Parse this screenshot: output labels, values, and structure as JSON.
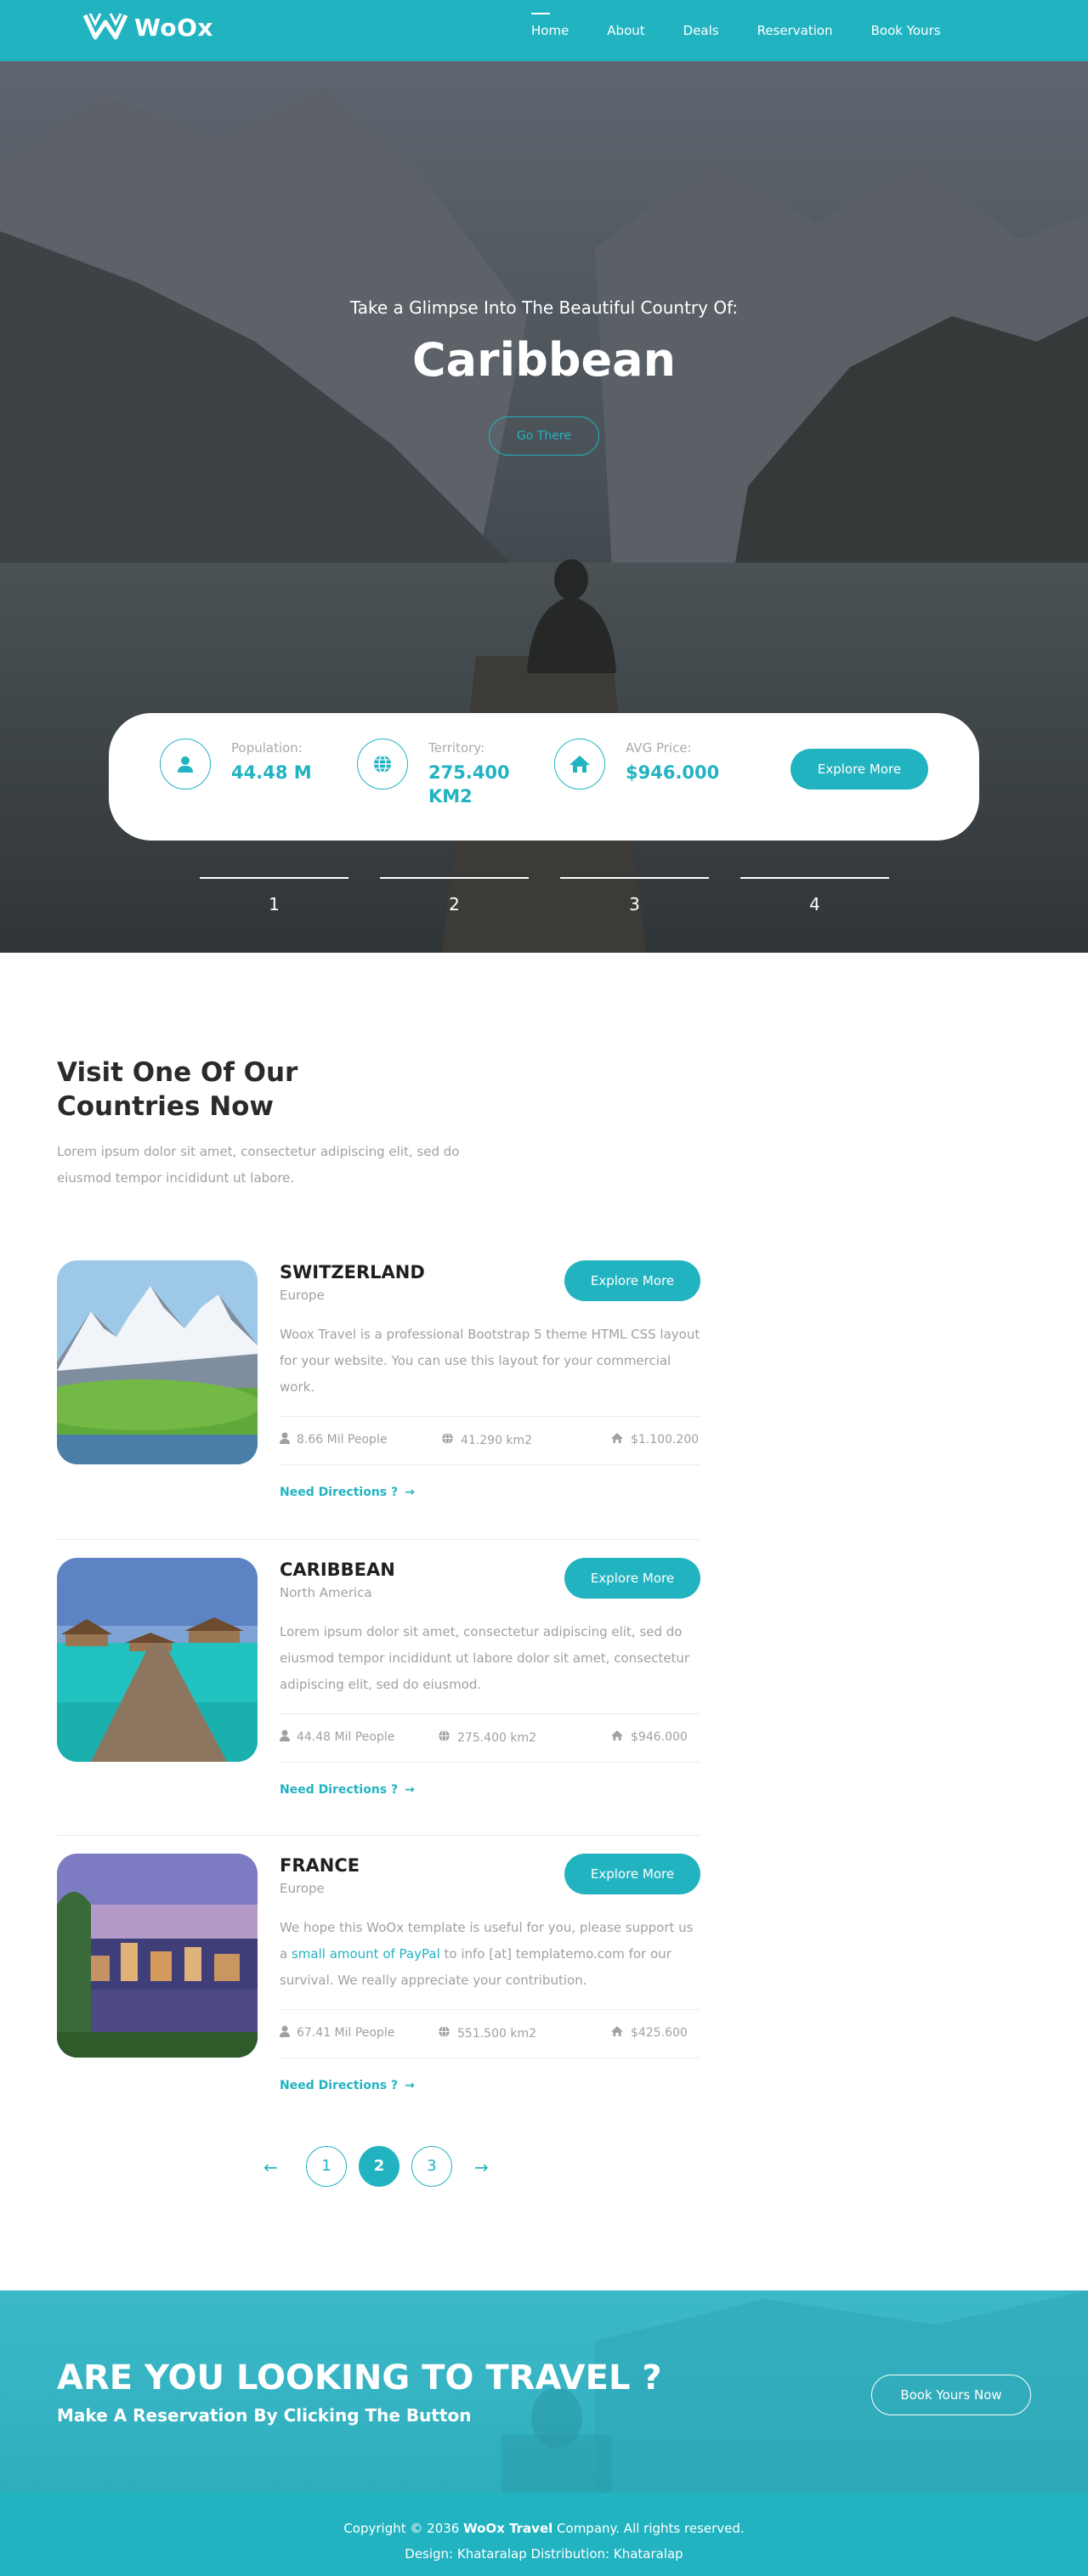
{
  "brand": {
    "name": "WoOx"
  },
  "nav": {
    "items": [
      {
        "label": "Home",
        "active": true
      },
      {
        "label": "About"
      },
      {
        "label": "Deals"
      },
      {
        "label": "Reservation"
      },
      {
        "label": "Book Yours"
      }
    ]
  },
  "hero": {
    "subtitle": "Take a Glimpse Into The Beautiful Country Of:",
    "title": "Caribbean",
    "cta_label": "Go There",
    "info": {
      "population": {
        "label": "Population:",
        "value": "44.48 M"
      },
      "territory": {
        "label": "Territory:",
        "value_line1": "275.400",
        "value_line2": "KM2"
      },
      "avg_price": {
        "label": "AVG Price:",
        "value": "$946.000"
      },
      "explore_label": "Explore More"
    },
    "slides": [
      "1",
      "2",
      "3",
      "4"
    ]
  },
  "countries_section": {
    "title": "Visit One Of Our Countries Now",
    "description": "Lorem ipsum dolor sit amet, consectetur adipiscing elit, sed do eiusmod tempor incididunt ut labore.",
    "items": [
      {
        "name": "SWITZERLAND",
        "region": "Europe",
        "explore_label": "Explore More",
        "description": "Woox Travel is a professional Bootstrap 5 theme HTML CSS layout for your website. You can use this layout for your commercial work.",
        "people": "8.66 Mil People",
        "area": "41.290 km2",
        "price": "$1.100.200",
        "directions_label": "Need Directions ?"
      },
      {
        "name": "CARIBBEAN",
        "region": "North America",
        "explore_label": "Explore More",
        "description": "Lorem ipsum dolor sit amet, consectetur adipiscing elit, sed do eiusmod tempor incididunt ut labore dolor sit amet, consectetur adipiscing elit, sed do eiusmod.",
        "people": "44.48 Mil People",
        "area": "275.400 km2",
        "price": "$946.000",
        "directions_label": "Need Directions ?"
      },
      {
        "name": "FRANCE",
        "region": "Europe",
        "explore_label": "Explore More",
        "description_before": "We hope this WoOx template is useful for you, please support us a ",
        "description_link": "small amount of PayPal",
        "description_after": " to info [at] templatemo.com for our survival. We really appreciate your contribution.",
        "people": "67.41 Mil People",
        "area": "551.500 km2",
        "price": "$425.600",
        "directions_label": "Need Directions ?"
      }
    ]
  },
  "pagination": {
    "pages": [
      "1",
      "2",
      "3"
    ],
    "active": "2"
  },
  "cta": {
    "title": "ARE YOU LOOKING TO TRAVEL ?",
    "subtitle": "Make A Reservation By Clicking The Button",
    "button_label": "Book Yours Now"
  },
  "footer": {
    "copyright_before": "Copyright © 2036 ",
    "copyright_company": "WoOx Travel",
    "copyright_after": " Company. All rights reserved.",
    "design_label": "Design: ",
    "design_by": "Khataralap",
    "distribution_label": " Distribution: ",
    "distribution_by": "Khataralap"
  },
  "colors": {
    "accent": "#22b3c1",
    "text_dark": "#2a2a2a",
    "text_muted": "#a0a0a0"
  }
}
